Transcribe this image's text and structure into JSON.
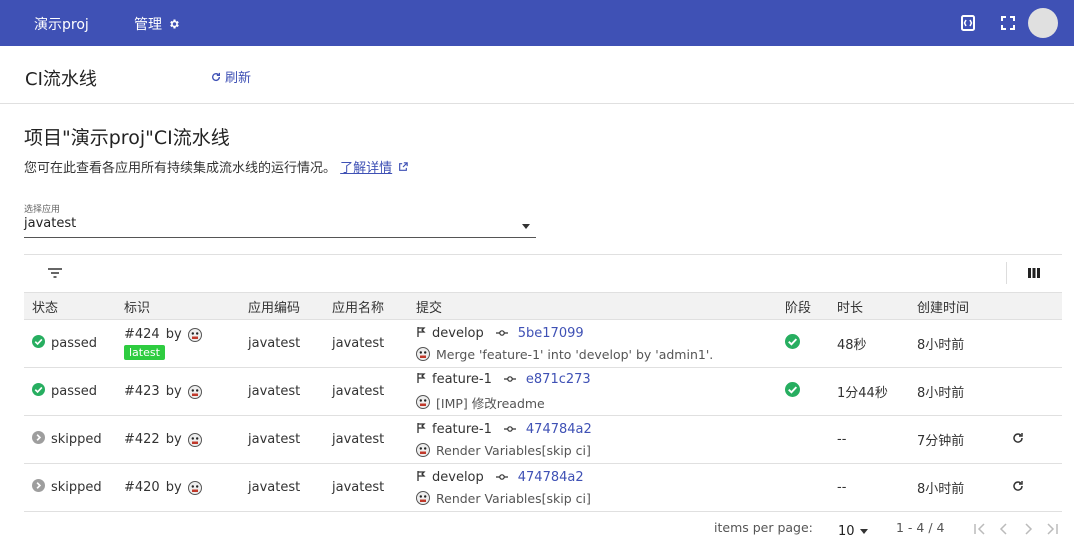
{
  "topbar": {
    "project": "演示proj",
    "manage": "管理"
  },
  "subbar": {
    "title": "CI流水线",
    "refresh": "刷新"
  },
  "heading": "项目\"演示proj\"CI流水线",
  "description": {
    "text": "您可在此查看各应用所有持续集成流水线的运行情况。",
    "link": "了解详情"
  },
  "app_select": {
    "label": "选择应用",
    "value": "javatest"
  },
  "table": {
    "headers": [
      "状态",
      "标识",
      "应用编码",
      "应用名称",
      "提交",
      "阶段",
      "时长",
      "创建时间"
    ],
    "rows": [
      {
        "status": "passed",
        "id": "#424",
        "by": "by",
        "badge": "latest",
        "code": "javatest",
        "name": "javatest",
        "branch": "develop",
        "sha": "5be17099",
        "message": "Merge 'feature-1' into 'develop' by 'admin1'.",
        "duration": "48秒",
        "created": "8小时前"
      },
      {
        "status": "passed",
        "id": "#423",
        "by": "by",
        "badge": "",
        "code": "javatest",
        "name": "javatest",
        "branch": "feature-1",
        "sha": "e871c273",
        "message": "[IMP] 修改readme",
        "duration": "1分44秒",
        "created": "8小时前"
      },
      {
        "status": "skipped",
        "id": "#422",
        "by": "by",
        "badge": "",
        "code": "javatest",
        "name": "javatest",
        "branch": "feature-1",
        "sha": "474784a2",
        "message": "Render Variables[skip ci]",
        "duration": "--",
        "created": "7分钟前"
      },
      {
        "status": "skipped",
        "id": "#420",
        "by": "by",
        "badge": "",
        "code": "javatest",
        "name": "javatest",
        "branch": "develop",
        "sha": "474784a2",
        "message": "Render Variables[skip ci]",
        "duration": "--",
        "created": "8小时前"
      }
    ]
  },
  "pager": {
    "items_per_page_label": "items per page:",
    "page_size": "10",
    "range": "1 - 4 / 4"
  },
  "colors": {
    "brand": "#3f51b5",
    "success": "#2ecc40",
    "passed_icon": "#27ae60",
    "skipped_icon": "#9e9e9e"
  }
}
